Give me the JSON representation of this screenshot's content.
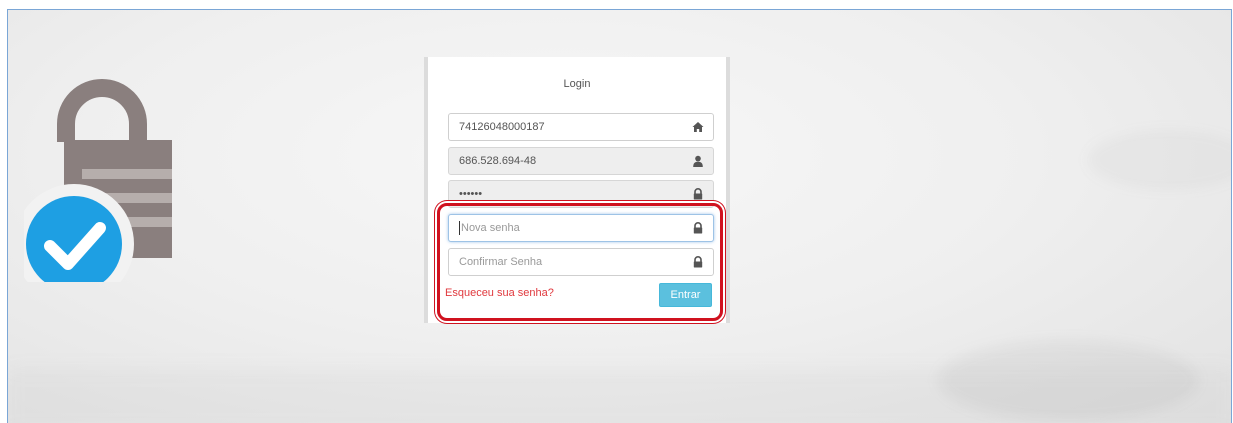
{
  "login": {
    "title": "Login",
    "fields": {
      "company": {
        "value": "74126048000187",
        "icon": "home-icon"
      },
      "user": {
        "value": "686.528.694-48",
        "icon": "user-icon"
      },
      "password": {
        "value": "••••••",
        "icon": "lock-icon"
      },
      "new_password": {
        "placeholder": "Nova senha",
        "icon": "lock-icon"
      },
      "confirm_password": {
        "placeholder": "Confirmar Senha",
        "icon": "lock-icon"
      }
    },
    "forgot_label": "Esqueceu sua senha?",
    "submit_label": "Entrar"
  },
  "colors": {
    "link": "#e0393e",
    "button": "#5bc0de",
    "highlight": "#d0121f",
    "check_badge": "#1e9fe3",
    "lock": "#8a7f7e"
  }
}
